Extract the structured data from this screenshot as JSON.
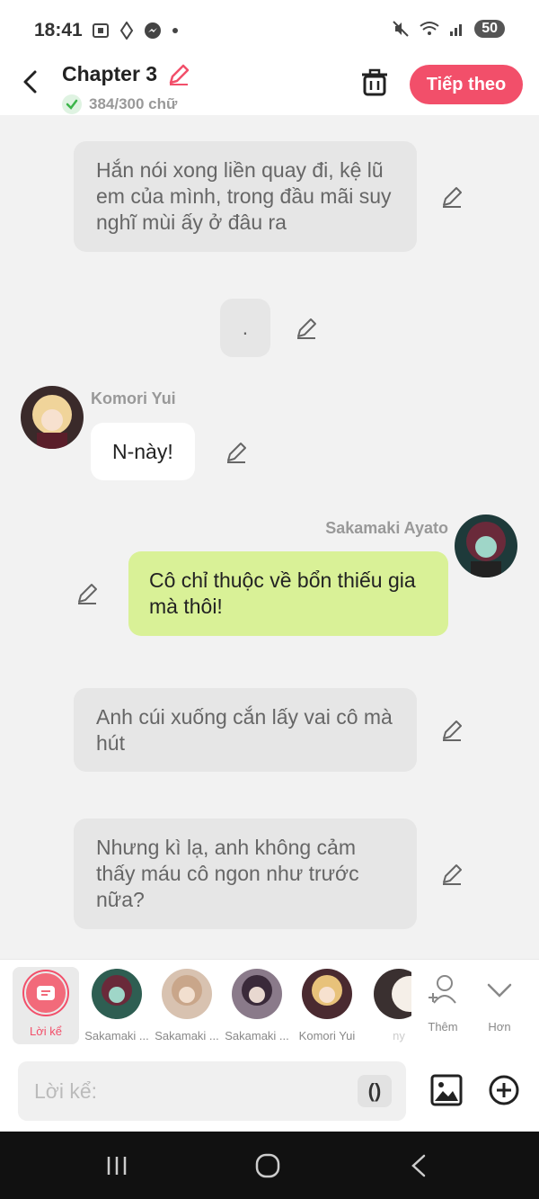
{
  "status_bar": {
    "time": "18:41",
    "battery": "50"
  },
  "header": {
    "title": "Chapter 3",
    "word_count": "384/300 chữ",
    "next_label": "Tiếp theo"
  },
  "messages": [
    {
      "type": "narration",
      "text": "Hắn nói xong liền quay đi, kệ lũ em của mình, trong đầu mãi suy nghĩ mùi ấy ở đâu ra"
    },
    {
      "type": "narration",
      "text": "."
    },
    {
      "type": "character_left",
      "name": "Komori Yui",
      "text": "N-này!"
    },
    {
      "type": "character_right",
      "name": "Sakamaki Ayato",
      "text": "Cô chỉ thuộc về bổn thiếu gia mà thôi!"
    },
    {
      "type": "narration",
      "text": "Anh cúi xuống cắn lấy vai cô mà hút"
    },
    {
      "type": "narration",
      "text": "Nhưng kì lạ, anh không cảm thấy máu cô ngon như trước nữa?"
    }
  ],
  "character_bar": {
    "narrator_label": "Lời kể",
    "characters": [
      {
        "label": "Sakamaki ...",
        "color": "#4f9e8a"
      },
      {
        "label": "Sakamaki ...",
        "color": "#c9a68a"
      },
      {
        "label": "Sakamaki ...",
        "color": "#6b5a7a"
      },
      {
        "label": "Komori Yui",
        "color": "#e8c27a"
      },
      {
        "label": "ny",
        "color": "#3a3030"
      }
    ],
    "more_label": "Thêm",
    "expand_label": "Hơn"
  },
  "input_bar": {
    "placeholder": "Lời kể:",
    "paren_label": "()"
  },
  "colors": {
    "accent": "#f24f6a",
    "narration_bg": "#e6e6e6",
    "right_bubble_bg": "#d9f197"
  }
}
